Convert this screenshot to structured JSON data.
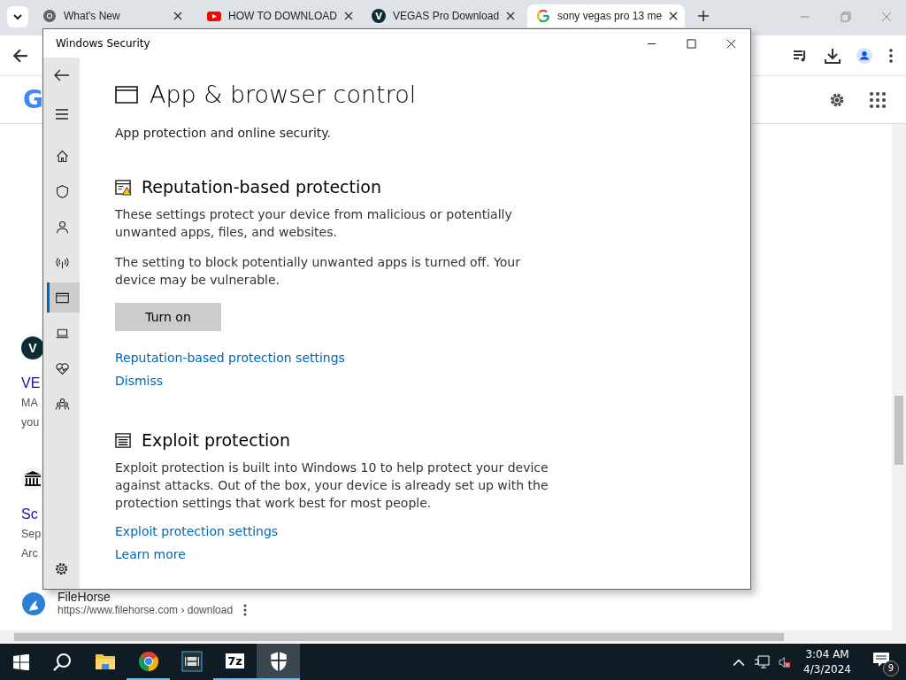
{
  "browser": {
    "tabs": [
      {
        "title": "What's New",
        "kind": "chrome",
        "selected": false
      },
      {
        "title": "HOW TO DOWNLOAD",
        "kind": "youtube",
        "selected": false
      },
      {
        "title": "VEGAS Pro Download",
        "kind": "letter",
        "letter": "V",
        "selected": false
      },
      {
        "title": "sony vegas pro 13 me",
        "kind": "google",
        "selected": true
      }
    ],
    "logo_letter": "G",
    "results": [
      {
        "kind": "letter",
        "letter": "V",
        "title": "VE",
        "lines": [
          "MA",
          "you"
        ]
      },
      {
        "kind": "building",
        "title": "Sc",
        "lines": [
          "Sep",
          "Arc"
        ]
      }
    ],
    "last_result": {
      "site": "FileHorse",
      "url": "https://www.filehorse.com › download"
    }
  },
  "security": {
    "title": "Windows Security",
    "nav": [
      {
        "kind": "home",
        "selected": false
      },
      {
        "kind": "shield",
        "selected": false
      },
      {
        "kind": "person",
        "selected": false
      },
      {
        "kind": "antenna",
        "selected": false
      },
      {
        "kind": "appbrowser",
        "selected": true
      },
      {
        "kind": "laptop",
        "selected": false
      },
      {
        "kind": "heart",
        "selected": false
      },
      {
        "kind": "family",
        "selected": false
      }
    ],
    "page_title": "App & browser control",
    "subtitle": "App protection and online security.",
    "sections": [
      {
        "kind": "reputation",
        "heading": "Reputation-based protection",
        "paragraphs": [
          "These settings protect your device from malicious or potentially unwanted apps, files, and websites.",
          "The setting to block potentially unwanted apps is turned off. Your device may be vulnerable."
        ],
        "button": "Turn on",
        "links": [
          "Reputation-based protection settings",
          "Dismiss"
        ]
      },
      {
        "kind": "exploit",
        "heading": "Exploit protection",
        "paragraphs": [
          "Exploit protection is built into Windows 10 to help protect your device against attacks.  Out of the box, your device is already set up with the protection settings that work best for most people."
        ],
        "links": [
          "Exploit protection settings",
          "Learn more"
        ]
      }
    ]
  },
  "taskbar": {
    "apps": [
      {
        "kind": "explorer",
        "running": false,
        "active": false
      },
      {
        "kind": "chrome",
        "running": true,
        "active": false
      },
      {
        "kind": "video",
        "running": false,
        "active": false
      },
      {
        "kind": "sevenzip",
        "label": "7z",
        "running": true,
        "active": false
      },
      {
        "kind": "security",
        "running": true,
        "active": true
      }
    ],
    "time": "3:04 AM",
    "date": "4/3/2024",
    "notifications": "9"
  }
}
